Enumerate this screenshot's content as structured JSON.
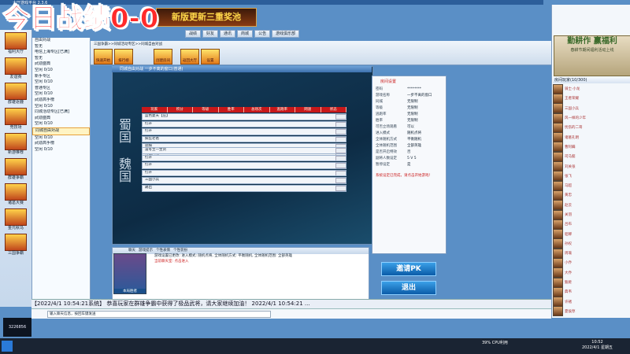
{
  "overlay": {
    "title": "今日战绩0-0"
  },
  "window": {
    "title": "大厅游戏平台 2.3.6"
  },
  "banner": {
    "text": "新版更新三重奖池"
  },
  "topnav": [
    "战绩",
    "好友",
    "通讯",
    "商城",
    "公告",
    "游戏俱乐部"
  ],
  "left_items": [
    "福利大厅",
    "友谊赛",
    "群雄逐鹿",
    "竞技场",
    "新游推荐",
    "群雄争霸",
    "诸葛大赛",
    "金元秋马",
    "三国争霸"
  ],
  "tree": {
    "items": [
      "自由对战",
      "暂无",
      "电信上海专区[已满]",
      "暂无",
      "武勋盛典",
      "空闲  0/10",
      "新手专区",
      "空闲  0/10",
      "普通专区",
      "空闲  0/10",
      "武勋高手榜",
      "空闲  0/10",
      "同城活动专区[已满]",
      "武勋盛典",
      "空闲  0/10",
      "同城自由对战",
      "空闲  0/10",
      "武勋高手榜",
      "空闲  0/10"
    ],
    "selected_index": 15
  },
  "toolbar": {
    "buttons": [
      "快速开始",
      "排行榜",
      "创建房间",
      "返回大厅",
      "设置"
    ]
  },
  "breadcrumb": "三国争霸>>同城活动专区>>同城自由对战",
  "game": {
    "title": "同城自由对战 一步不离的窗口(普通)",
    "factions": [
      "蜀国",
      "魏国"
    ],
    "headers": [
      "玩家",
      "积分",
      "等级",
      "胜率",
      "总场次",
      "逃跑率",
      "网速",
      "状态"
    ],
    "shu_rows": [
      "蓝色夏天【庄】",
      "打开",
      "打开",
      "疯狂老爸",
      "骁騎",
      "踢出开始"
    ],
    "wei_rows": [
      "凌冬至一生剑",
      "打开",
      "打开",
      "打开",
      "三国小兵",
      "踢出"
    ]
  },
  "settings": {
    "title": "房间设置",
    "rows": [
      {
        "k": "密码",
        "v": "********"
      },
      {
        "k": "游戏名称",
        "v": "一步不离的窗口"
      },
      {
        "k": "同城",
        "v": "无限制"
      },
      {
        "k": "等级",
        "v": "无限制"
      },
      {
        "k": "逃跑率",
        "v": "无限制"
      },
      {
        "k": "胜率",
        "v": "无限制"
      },
      {
        "k": "可否立场观看",
        "v": "可以"
      },
      {
        "k": "进入模式",
        "v": "随机点将"
      },
      {
        "k": "全体随机方式",
        "v": "平衡随机"
      },
      {
        "k": "全体随机范围",
        "v": "全部英雄"
      },
      {
        "k": "是否开启特效",
        "v": "否"
      },
      {
        "k": "副将人数设定",
        "v": "5 V 5"
      },
      {
        "k": "暂停设定",
        "v": "是"
      }
    ],
    "hint": "系统设定已完成，请点击开始游戏！"
  },
  "buttons": {
    "pk": "邀请PK",
    "exit": "退出"
  },
  "chat": {
    "tabs": [
      "聊天",
      "游戏提示",
      "个性表情",
      "个性装扮"
    ],
    "lines": [
      "游戏设置已更改: 进入模式: 随机点将, 全体随机方式: 平衡随机, 全体随机范围: 全部英雄",
      "当前聊天室: 点击进入"
    ],
    "avatar_label": "本局胜者"
  },
  "ticker": "【2022/4/1 10:54:21系统】 恭喜玩家在群雄争霸中获得了极品武将，请大家继续加油！ 2022/4/1 10:54:21 ...",
  "input": {
    "placeholder": "输入聊天信息，按回车键发送"
  },
  "right": {
    "promo_title": "勤耕作 赢福利",
    "promo_sub": "春耕节期间福利活动上线",
    "online_header": "房间玩家(10/300)",
    "users": [
      "骑士·小龙",
      "王者荣耀",
      "三国小兵",
      "风一样的少年",
      "忧伤的二哥",
      "诸葛孔明",
      "曹阿瞒",
      "司马懿",
      "刘关张",
      "张飞",
      "马超",
      "黄忠",
      "赵云",
      "关羽",
      "吕布",
      "貂蝉",
      "孙权",
      "周瑜",
      "小乔",
      "大乔",
      "甄姬",
      "典韦",
      "许褚",
      "夏侯惇"
    ]
  },
  "taskbar": {
    "time": "10:52",
    "date": "2022/4/1 星期五",
    "cpu": "39% CPU利用"
  },
  "counter": {
    "value": "3226856"
  }
}
